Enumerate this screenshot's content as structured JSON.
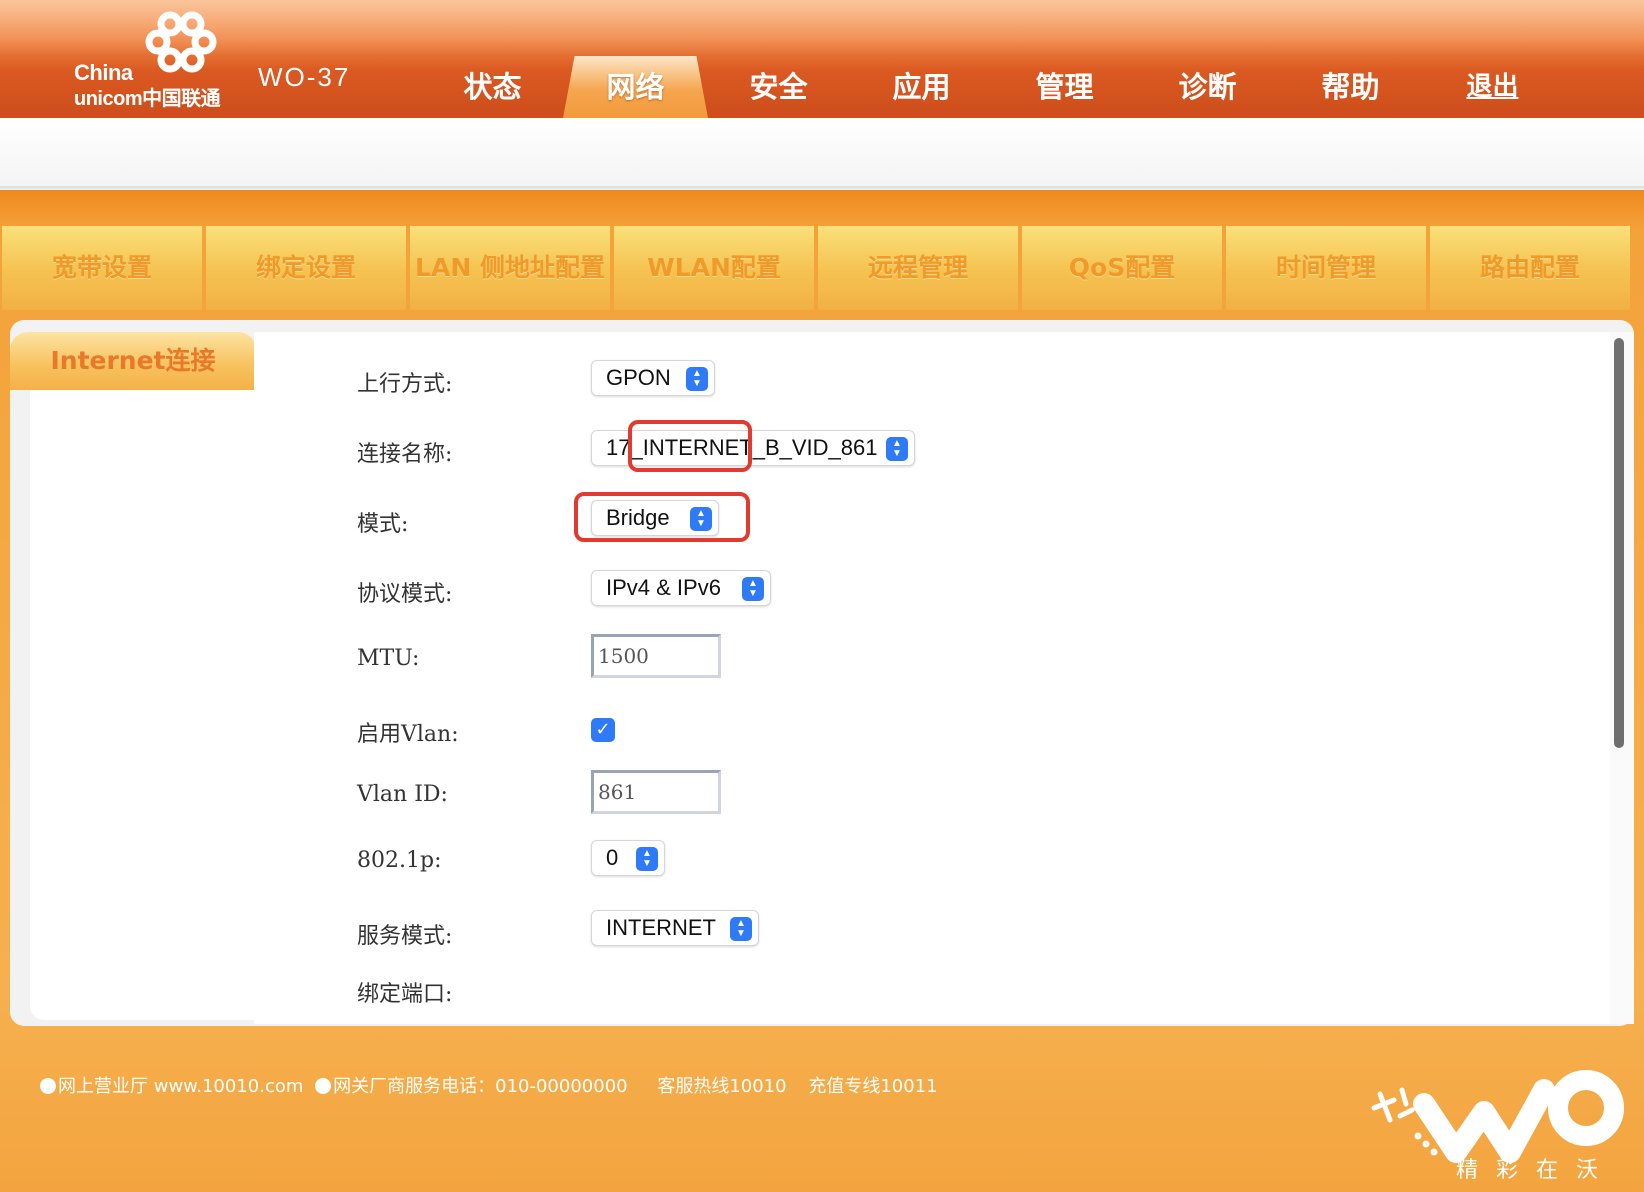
{
  "header": {
    "brand_en_1": "China",
    "brand_en_2": "unicom中国联通",
    "model": "WO-37"
  },
  "main_nav": [
    {
      "label": "状态"
    },
    {
      "label": "网络"
    },
    {
      "label": "安全"
    },
    {
      "label": "应用"
    },
    {
      "label": "管理"
    },
    {
      "label": "诊断"
    },
    {
      "label": "帮助"
    },
    {
      "label": "退出"
    }
  ],
  "active_main_tab": "网络",
  "sub_nav": [
    {
      "label": "宽带设置"
    },
    {
      "label": "绑定设置"
    },
    {
      "label": "LAN 侧地址配置"
    },
    {
      "label": "WLAN配置"
    },
    {
      "label": "远程管理"
    },
    {
      "label": "QoS配置"
    },
    {
      "label": "时间管理"
    },
    {
      "label": "路由配置"
    }
  ],
  "side_tab": "Internet连接",
  "form": {
    "uplink_label": "上行方式:",
    "uplink_value": "GPON",
    "conn_name_label": "连接名称:",
    "conn_name_value": "17_INTERNET_B_VID_861",
    "mode_label": "模式:",
    "mode_value": "Bridge",
    "protocol_label": "协议模式:",
    "protocol_value": "IPv4 & IPv6",
    "mtu_label": "MTU:",
    "mtu_value": "1500",
    "vlan_enable_label": "启用Vlan:",
    "vlan_enabled": true,
    "vlan_id_label": "Vlan ID:",
    "vlan_id_value": "861",
    "p8021_label": "802.1p:",
    "p8021_value": "0",
    "service_mode_label": "服务模式:",
    "service_mode_value": "INTERNET",
    "bind_port_label": "绑定端口:"
  },
  "footer": {
    "item1": "网上营业厅 www.10010.com",
    "item2": "网关厂商服务电话：010-00000000",
    "item3": "客服热线10010",
    "item4": "充值专线10011",
    "slogan": "精彩在沃"
  },
  "colors": {
    "header_orange": "#d9561f",
    "frame_orange": "#f4a23a",
    "highlight_red": "#e23a2e",
    "select_blue": "#2f7af6"
  }
}
